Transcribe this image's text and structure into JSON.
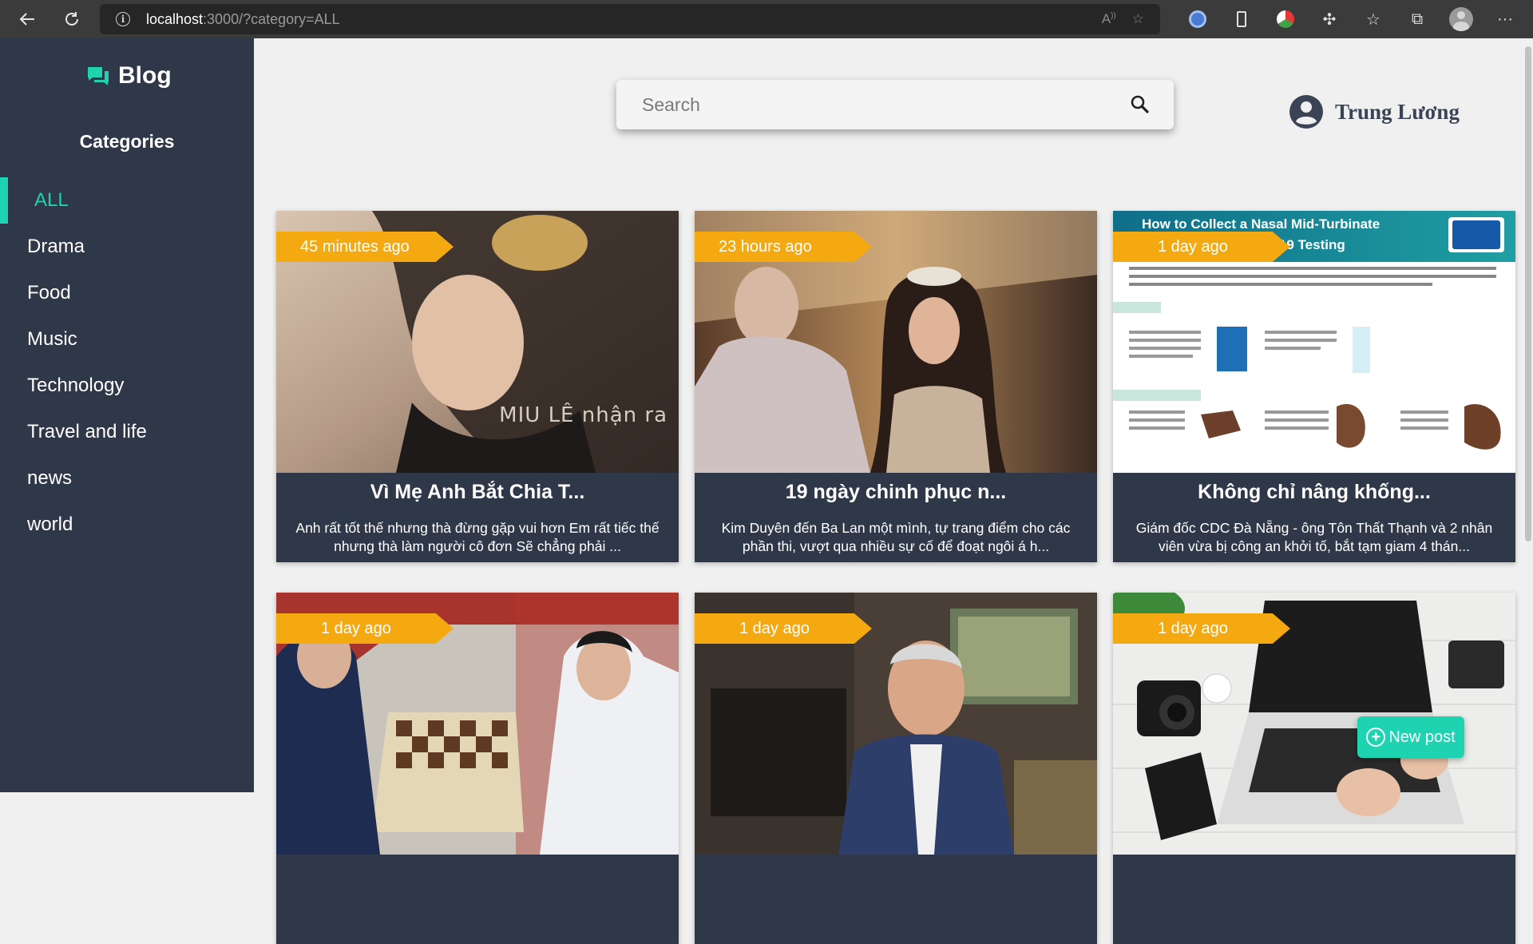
{
  "browser": {
    "url_host": "localhost",
    "url_path": ":3000/?category=ALL",
    "icons": [
      "back-icon",
      "reload-icon",
      "info-icon",
      "read-aloud-icon",
      "add-favorite-icon",
      "extension-icon",
      "phone-icon",
      "extension-icon",
      "puzzle-icon",
      "favorites-icon",
      "collections-icon",
      "profile-icon",
      "more-icon"
    ]
  },
  "sidebar": {
    "brand": "Blog",
    "categories_title": "Categories",
    "items": [
      {
        "label": "ALL",
        "active": true
      },
      {
        "label": "Drama"
      },
      {
        "label": "Food"
      },
      {
        "label": "Music"
      },
      {
        "label": "Technology"
      },
      {
        "label": "Travel and life"
      },
      {
        "label": "news"
      },
      {
        "label": "world"
      }
    ]
  },
  "search": {
    "placeholder": "Search"
  },
  "user": {
    "name": "Trung Lương"
  },
  "posts": [
    {
      "time": "45 minutes ago",
      "title": "Vì Mẹ Anh Bắt Chia T...",
      "excerpt": "Anh rất tốt thế nhưng thà đừng gặp vui hơn Em rất tiếc thế nhưng thà làm người cô đơn Sẽ chẳng phải ...",
      "image_text": "MIU LÊ nhận ra"
    },
    {
      "time": "23 hours ago",
      "title": "19 ngày chinh phục n...",
      "excerpt": "Kim Duyên đến Ba Lan một mình, tự trang điểm cho các phần thi, vượt qua nhiều sự cố để đoạt ngôi á h..."
    },
    {
      "time": "1 day ago",
      "title": "Không chỉ nâng khống...",
      "excerpt": "Giám đốc CDC Đà Nẵng - ông Tôn Thất Thạnh và 2 nhân viên vừa bị công an khởi tố, bắt tạm giam 4 thán...",
      "image_text": "How to Collect a Nasal Mid-Turbinate Specimen for COVID-19 Testing"
    },
    {
      "time": "1 day ago"
    },
    {
      "time": "1 day ago"
    },
    {
      "time": "1 day ago"
    }
  ],
  "new_post_label": "New post",
  "colors": {
    "sidebar": "#2f3849",
    "accent": "#1dd3b0",
    "tag": "#f5a911",
    "background": "#f0f0f0"
  }
}
